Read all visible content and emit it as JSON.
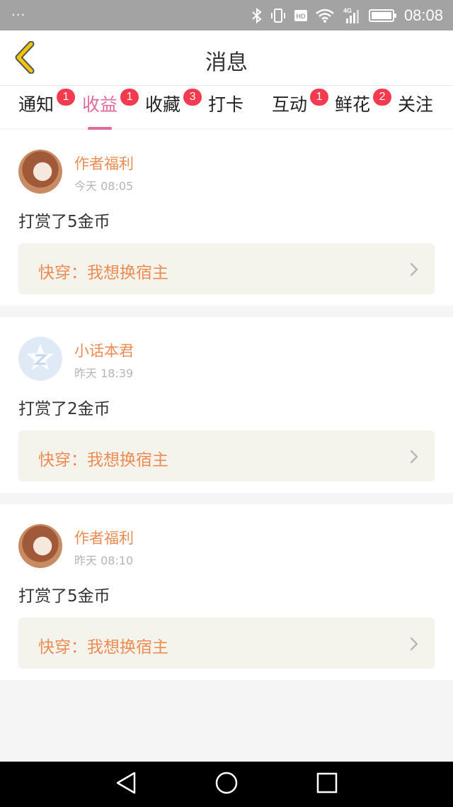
{
  "status_bar": {
    "dots": "···",
    "time": "08:08",
    "hd_label": "HD",
    "network_label": "4G",
    "icons": [
      "bluetooth-icon",
      "vibrate-icon",
      "hd-icon",
      "wifi-icon",
      "cellular-signal-icon",
      "battery-icon"
    ]
  },
  "header": {
    "title": "消息",
    "back_icon": "back-chevron-icon",
    "accent_color": "#f2c500"
  },
  "tabs": [
    {
      "label": "通知",
      "badge": "1",
      "active": false
    },
    {
      "label": "收益",
      "badge": "1",
      "active": true
    },
    {
      "label": "收藏",
      "badge": "3",
      "active": false
    },
    {
      "label": "打卡",
      "badge": "",
      "active": false
    },
    {
      "label": "互动",
      "badge": "1",
      "active": false
    },
    {
      "label": "鲜花",
      "badge": "2",
      "active": false
    },
    {
      "label": "关注",
      "badge": "",
      "active": false
    }
  ],
  "colors": {
    "active_tab": "#e26a9e",
    "badge": "#f43a4f",
    "author": "#ec8c53",
    "book_link_bg": "#f4f3ec"
  },
  "messages": [
    {
      "author": "作者福利",
      "time": "今天 08:05",
      "text": "打赏了5金币",
      "book": "快穿：我想换宿主",
      "avatar": "anime-avatar"
    },
    {
      "author": "小话本君",
      "time": "昨天 18:39",
      "text": "打赏了2金币",
      "book": "快穿：我想换宿主",
      "avatar": "default-avatar"
    },
    {
      "author": "作者福利",
      "time": "昨天 08:10",
      "text": "打赏了5金币",
      "book": "快穿：我想换宿主",
      "avatar": "anime-avatar"
    }
  ],
  "nav_bar": {
    "icons": [
      "back-triangle-icon",
      "home-circle-icon",
      "recents-square-icon"
    ]
  }
}
